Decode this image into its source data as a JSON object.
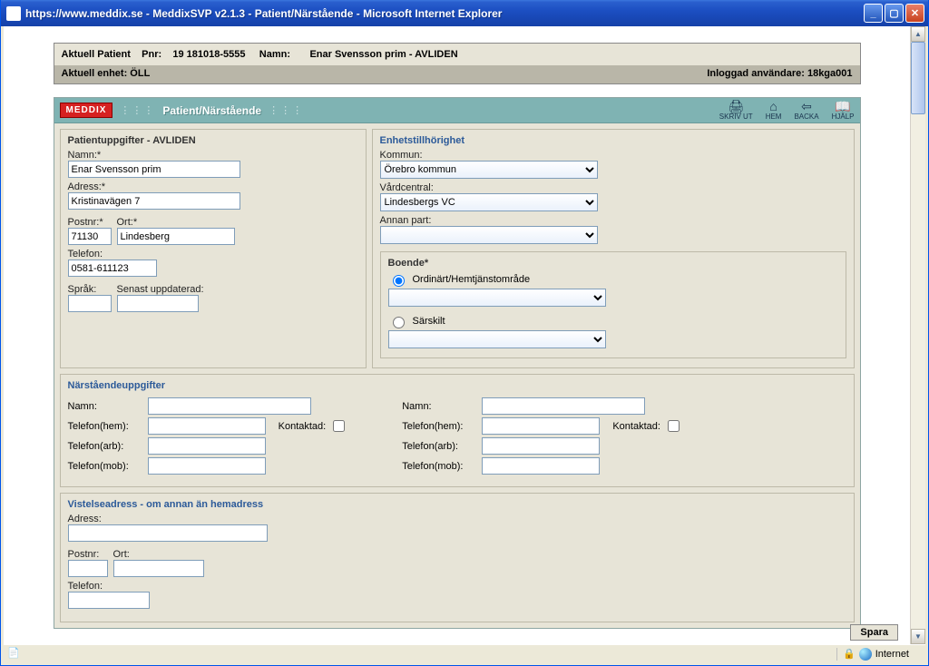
{
  "window": {
    "title": "https://www.meddix.se - MeddixSVP v2.1.3 - Patient/Närstående - Microsoft Internet Explorer"
  },
  "patient_header": {
    "label": "Aktuell Patient",
    "pnr_label": "Pnr:",
    "pnr_value": "19 181018-5555",
    "name_label": "Namn:",
    "name_value": "Enar Svensson prim - AVLIDEN"
  },
  "unit_header": {
    "left_label": "Aktuell enhet:",
    "left_value": "ÖLL",
    "right_label": "Inloggad användare:",
    "right_value": "18kga001"
  },
  "toolbar": {
    "logo": "MEDDIX",
    "page_title": "Patient/Närstående",
    "print": "SKRIV UT",
    "home": "HEM",
    "back": "BACKA",
    "help": "HJÄLP"
  },
  "patient_section": {
    "title": "Patientuppgifter - AVLIDEN",
    "name_label": "Namn:*",
    "name_value": "Enar Svensson prim",
    "address_label": "Adress:*",
    "address_value": "Kristinavägen 7",
    "postnr_label": "Postnr:*",
    "postnr_value": "71130",
    "ort_label": "Ort:*",
    "ort_value": "Lindesberg",
    "phone_label": "Telefon:",
    "phone_value": "0581-611123",
    "lang_label": "Språk:",
    "lang_value": "",
    "updated_label": "Senast uppdaterad:",
    "updated_value": ""
  },
  "unit_section": {
    "title": "Enhetstillhörighet",
    "kommun_label": "Kommun:",
    "kommun_value": "Örebro kommun",
    "vc_label": "Vårdcentral:",
    "vc_value": "Lindesbergs VC",
    "other_label": "Annan part:",
    "other_value": ""
  },
  "boende_section": {
    "title": "Boende*",
    "opt1": "Ordinärt/Hemtjänstområde",
    "opt2": "Särskilt"
  },
  "kin_section": {
    "title": "Närståendeuppgifter",
    "name_label": "Namn:",
    "hem_label": "Telefon(hem):",
    "arb_label": "Telefon(arb):",
    "mob_label": "Telefon(mob):",
    "kontakt_label": "Kontaktad:"
  },
  "stay_section": {
    "title": "Vistelseadress - om annan än hemadress",
    "address_label": "Adress:",
    "postnr_label": "Postnr:",
    "ort_label": "Ort:",
    "phone_label": "Telefon:"
  },
  "buttons": {
    "save": "Spara"
  },
  "statusbar": {
    "zone": "Internet"
  }
}
